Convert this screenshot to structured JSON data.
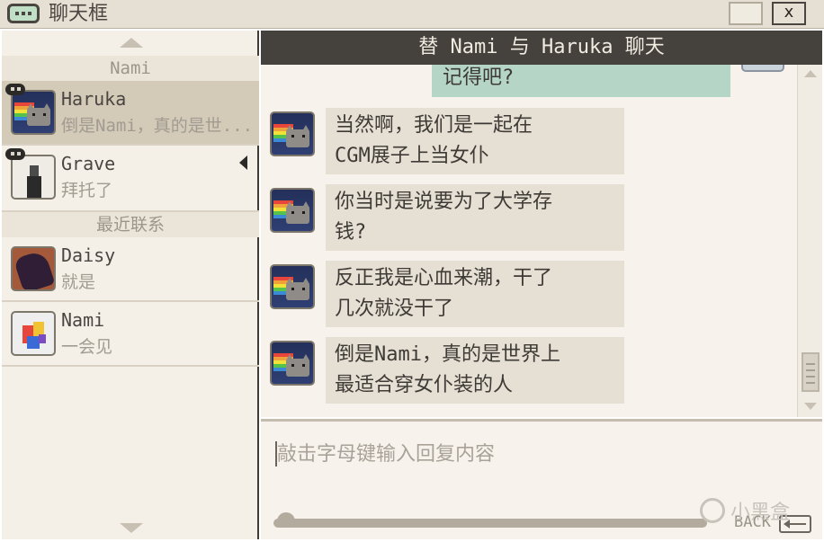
{
  "window": {
    "title": "聊天框",
    "close_label": "x"
  },
  "sidebar": {
    "group_current": "Nami",
    "group_recent": "最近联系",
    "contacts": [
      {
        "name": "Haruka",
        "preview": "倒是Nami，真的是世...",
        "avatar": "nyan-cat-avatar",
        "active": true,
        "mood_badge": true
      },
      {
        "name": "Grave",
        "preview": "拜托了",
        "avatar": "man-in-suit-avatar",
        "active": false,
        "mood_badge": true,
        "playing_indicator": true
      },
      {
        "name": "Daisy",
        "preview": "就是",
        "avatar": "dark-hair-girl-avatar",
        "active": false
      },
      {
        "name": "Nami",
        "preview": "一会见",
        "avatar": "color-blocks-avatar",
        "active": false
      }
    ]
  },
  "chat": {
    "header": "替 Nami 与 Haruka 聊天",
    "outgoing_partial": "记得吧?",
    "messages": [
      {
        "line1": "当然啊，我们是一起在",
        "line2": "CGM展子上当女仆"
      },
      {
        "line1": "你当时是说要为了大学存",
        "line2": "钱?"
      },
      {
        "line1": "反正我是心血来潮，干了",
        "line2": "几次就没干了"
      },
      {
        "line1": "倒是Nami，真的是世界上",
        "line2": "最适合穿女仆装的人"
      }
    ]
  },
  "input": {
    "placeholder": "敲击字母键输入回复内容",
    "value": ""
  },
  "back_button": {
    "label": "BACK"
  },
  "watermark": {
    "text": "小黑盒"
  },
  "colors": {
    "header_bg": "#45413c",
    "outgoing_bubble": "#b5d5c6",
    "incoming_bubble": "#e5dfd4",
    "active_contact": "#d3cab8"
  }
}
